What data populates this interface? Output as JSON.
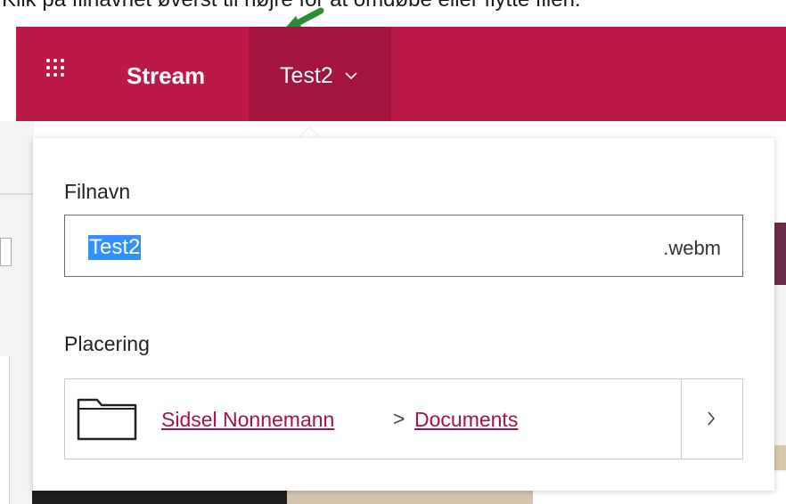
{
  "instruction": "Klik på filnavnet øverst til højre for at omdøbe eller flytte filen.",
  "topbar": {
    "app_name": "Stream",
    "file_tab_label": "Test2",
    "color": "#bb1a47",
    "tab_active_color": "#a3153e"
  },
  "flyout": {
    "filename_label": "Filnavn",
    "filename_value": "Test2",
    "extension": ".webm",
    "location_label": "Placering",
    "location_path": [
      "Sidsel Nonnemann",
      "Documents"
    ],
    "path_separator": ">"
  },
  "icons": [
    "waffle-icon",
    "chevron-down-icon",
    "folder-icon",
    "chevron-right-icon",
    "green-arrow-icon"
  ]
}
